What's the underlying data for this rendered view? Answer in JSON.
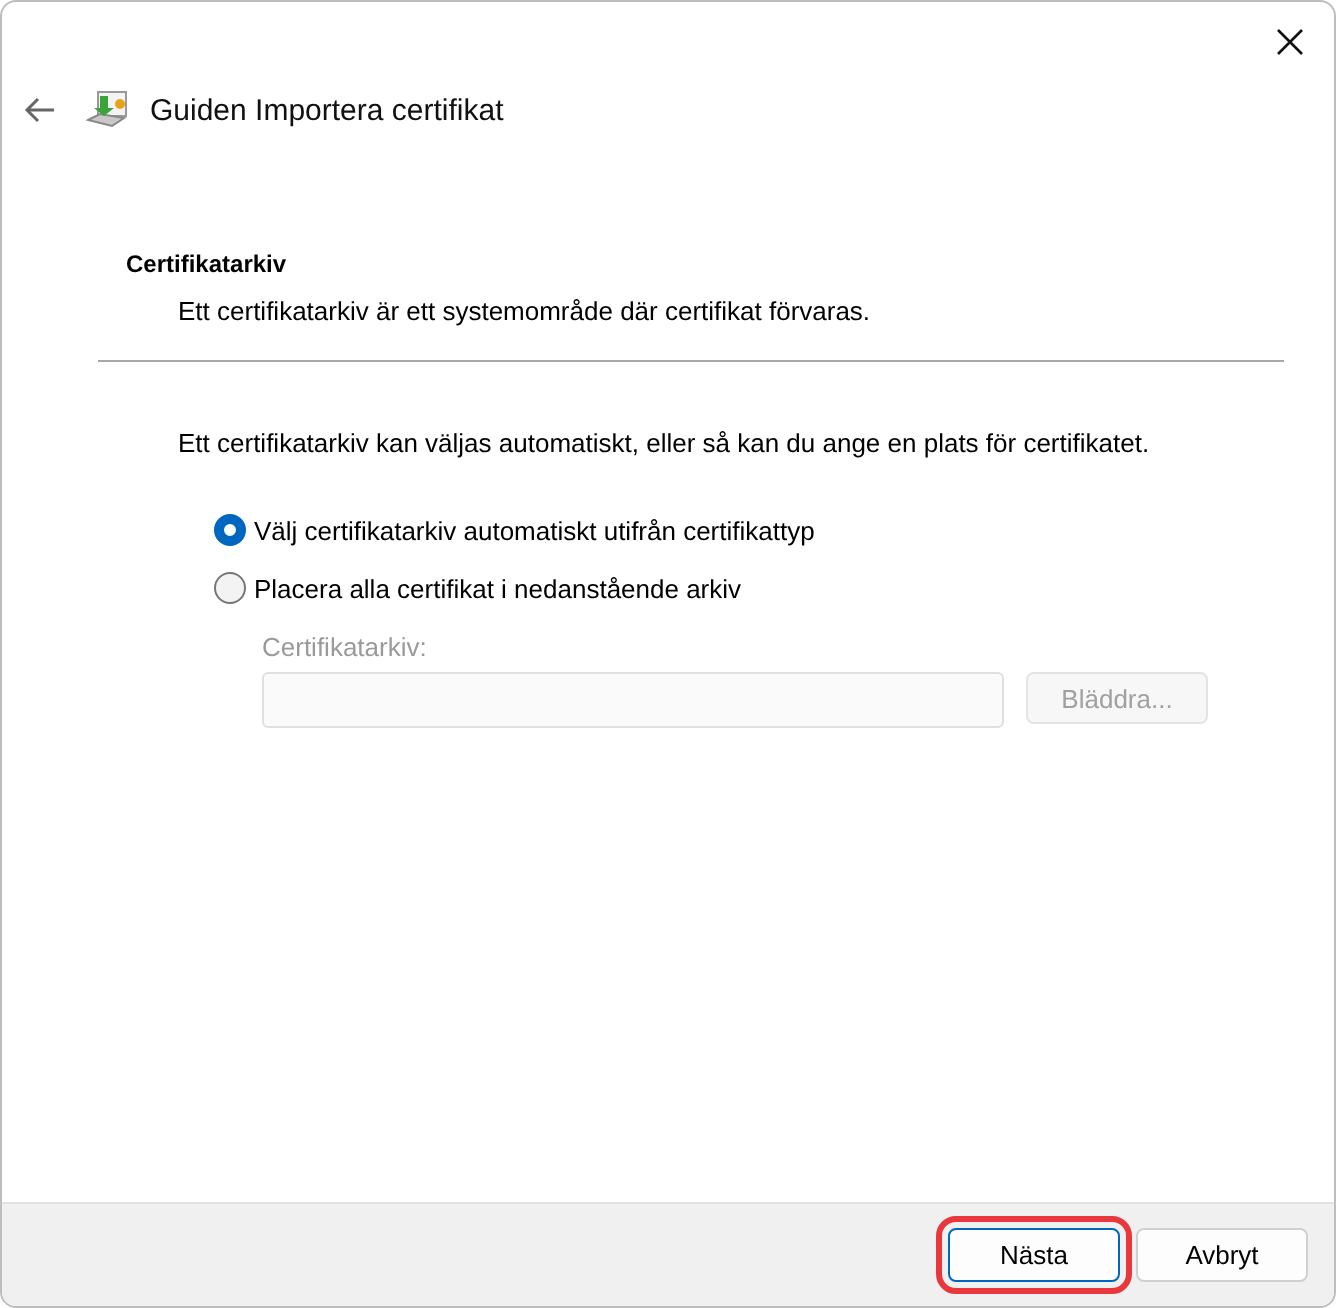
{
  "window": {
    "title": "Guiden Importera certifikat"
  },
  "section": {
    "heading": "Certifikatarkiv",
    "description": "Ett certifikatarkiv är ett systemområde där certifikat förvaras."
  },
  "intro": "Ett certifikatarkiv kan väljas automatiskt, eller så kan du ange en plats för certifikatet.",
  "options": [
    {
      "label": "Välj certifikatarkiv automatiskt utifrån certifikattyp",
      "selected": true
    },
    {
      "label": "Placera alla certifikat i nedanstående arkiv",
      "selected": false
    }
  ],
  "store_field": {
    "label": "Certifikatarkiv:",
    "disabled": true,
    "browse_button": "Bläddra..."
  },
  "buttons": [
    {
      "label": "Nästa",
      "highlighted": true
    },
    {
      "label": "Avbryt",
      "highlighted": false
    }
  ]
}
